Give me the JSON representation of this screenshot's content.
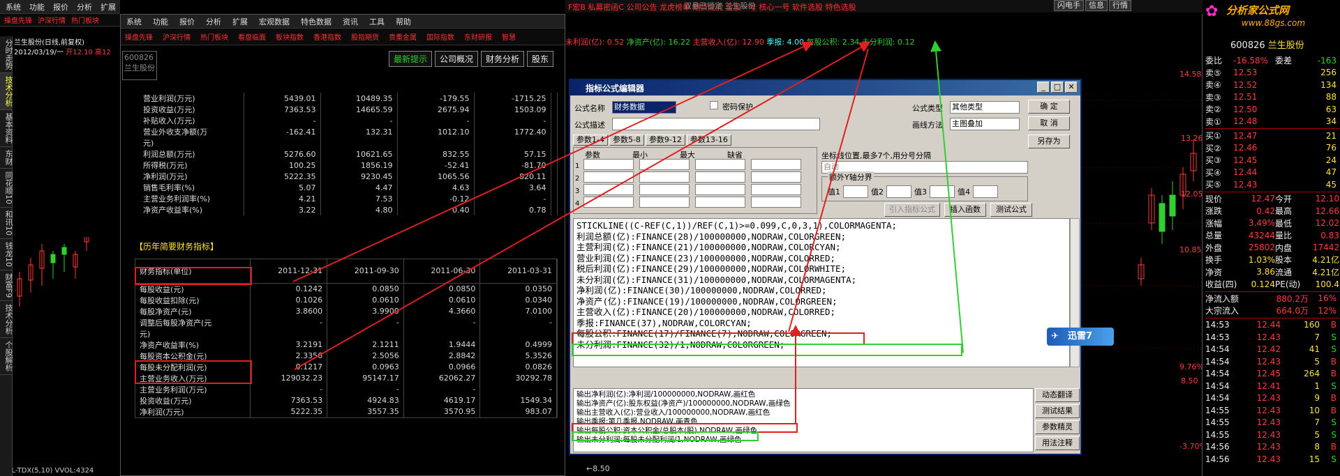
{
  "left_menu": [
    "系统",
    "功能",
    "报价",
    "分析",
    "扩展"
  ],
  "left_redbar": [
    "操盘先锋",
    "沪深行情",
    "热门板块"
  ],
  "vtabs": [
    "分时走势",
    "技术分析",
    "基本资料",
    "东财",
    "同花顺10",
    "和讯10",
    "钱龙10",
    "财富F9",
    "技术分析",
    "个股解析"
  ],
  "left_info": {
    "name": "兰生股份(日线,前复权)",
    "date": "2012/03/19/一",
    "open_label": "开12.10",
    "high_label": "高12"
  },
  "left_bottom": "VOL-TDX(5,10) VVOL:4324",
  "fin_menu": [
    "系统",
    "功能",
    "报价",
    "分析",
    "扩展",
    "宏观数据",
    "特色数据",
    "资讯",
    "工具",
    "帮助"
  ],
  "fin_redbar": [
    "操盘先锋",
    "沪深行情",
    "热门板块",
    "看盘临面",
    "板块指数",
    "香港指数",
    "股指期货",
    "贵重金属",
    "国际指数",
    "东财研报",
    "智慧"
  ],
  "fin_code": "600826",
  "fin_name": "兰生股份",
  "fin_tabs": [
    "最新提示",
    "公司概况",
    "财务分析",
    "股东"
  ],
  "fin_rows1": [
    [
      "营业利润(万元)",
      "5439.01",
      "10489.35",
      "-179.55",
      "-1715.25"
    ],
    [
      "投资收益(万元)",
      "7363.53",
      "14665.59",
      "2675.94",
      "1503.09"
    ],
    [
      "补贴收入(万元)",
      "-",
      "-",
      "-",
      "-"
    ],
    [
      "营业外收支净额(万",
      "-162.41",
      "132.31",
      "1012.10",
      "1772.40"
    ],
    [
      "元)",
      "",
      "",
      "",
      ""
    ],
    [
      "利润总额(万元)",
      "5276.60",
      "10621.65",
      "832.55",
      "57.15"
    ],
    [
      "所得税(万元)",
      "100.25",
      "1856.19",
      "-52.41",
      "-81.70"
    ],
    [
      "净利润(万元)",
      "5222.35",
      "9230.45",
      "1065.56",
      "820.11"
    ],
    [
      "销售毛利率(%)",
      "5.07",
      "4.47",
      "4.63",
      "3.64"
    ],
    [
      "主营业务利润率(%)",
      "4.21",
      "7.53",
      "-0.12",
      "-"
    ],
    [
      "净资产收益率(%)",
      "3.22",
      "4.80",
      "0.40",
      "0.78"
    ]
  ],
  "fin_section": "【历年简要财务指标】",
  "fin_header": [
    "财务指标(单位)",
    "2011-12-31",
    "2011-09-30",
    "2011-06-30",
    "2011-03-31"
  ],
  "fin_rows2": [
    [
      "每股收益(元)",
      "0.1242",
      "0.0850",
      "0.0850",
      "0.0350"
    ],
    [
      "每股收益扣除(元)",
      "0.1026",
      "0.0610",
      "0.0610",
      "0.0340"
    ],
    [
      "每股净资产(元)",
      "3.8600",
      "3.9900",
      "4.3660",
      "7.0100"
    ],
    [
      "调整后每股净资产(元",
      "-",
      "-",
      "-",
      "-"
    ],
    [
      "元)",
      "",
      "",
      "",
      ""
    ],
    [
      "净资产收益率(%)",
      "3.2191",
      "2.1211",
      "1.9444",
      "0.4999"
    ],
    [
      "每股资本公积金(元)",
      "2.3356",
      "2.5056",
      "2.8842",
      "5.3526"
    ],
    [
      "每股未分配利润(元)",
      "0.1217",
      "0.0963",
      "0.0966",
      "0.0826"
    ],
    [
      "主营业务收入(万元)",
      "129032.23",
      "95147.17",
      "62062.27",
      "30292.78"
    ],
    [
      "主营业务利润(万元)",
      "-",
      "-",
      "-",
      "-"
    ],
    [
      "投资收益(万元)",
      "7363.53",
      "4924.83",
      "4619.17",
      "1549.34"
    ],
    [
      "净利润(万元)",
      "5222.35",
      "3557.35",
      "3570.95",
      "983.07"
    ]
  ],
  "chart_top": {
    "bar": "F宏B  私募密函C  公司公告  龙虎榜单  期货龙虎  金股一号  核心一号  软件选股  特色选股",
    "title": "双悬已锁定 兰生股份",
    "status": [
      "闪电手",
      "信息",
      "行情"
    ]
  },
  "indicator_line": {
    "p1": "未利润(亿): 0.52",
    "p2": "净资产(亿): 16.22",
    "p3": "主营收入(亿): 12.90",
    "p4": "季报: 4.00",
    "p5": "每股公积: 2.34",
    "p6": "未分利润: 0.12"
  },
  "price_axis": [
    "14.58%",
    "13.26",
    "12.05",
    "10.85%",
    "9.76%",
    "8.50",
    "-3.70%"
  ],
  "bottom_axis": "←8.50",
  "dialog": {
    "title": "指标公式编辑器",
    "name_label": "公式名称",
    "name_value": "财务数据",
    "pwd_label": "密码保护",
    "desc_label": "公式描述",
    "type_label": "公式类型",
    "type_value": "其他类型",
    "draw_label": "画线方法",
    "draw_value": "主图叠加",
    "btn_ok": "确  定",
    "btn_cancel": "取  消",
    "btn_saveas": "另存为",
    "param_tabs": [
      "参数1-4",
      "参数5-8",
      "参数9-12",
      "参数13-16"
    ],
    "param_headers": [
      "参数",
      "最小",
      "最大",
      "缺省"
    ],
    "coord_label": "坐标线位置,最多7个,用分号分隔",
    "coord_value": "自动",
    "yaxis_label": "额外Y轴分界",
    "yvals": [
      "值1",
      "值2",
      "值3",
      "值4"
    ],
    "btn_import": "引入指标公式",
    "btn_insert": "插入函数",
    "btn_test": "测试公式",
    "code": [
      "STICKLINE((C-REF(C,1))/REF(C,1)>=0.099,C,0,3,1),COLORMAGENTA;",
      "利润总额(亿):FINANCE(28)/100000000,NODRAW,COLORGREEN;",
      "主营利润(亿):FINANCE(21)/100000000,NODRAW,COLORCYAN;",
      "营业利润(亿):FINANCE(23)/100000000,NODRAW,COLORRED;",
      "税后利润(亿):FINANCE(29)/100000000,NODRAW,COLORWHITE;",
      "未分利润(亿):FINANCE(31)/100000000,NODRAW,COLORMAGENTA;",
      "净利润(亿):FINANCE(30)/100000000,NODRAW,COLORRED;",
      "净资产(亿):FINANCE(19)/100000000,NODRAW,COLORGREEN;",
      "主营收入(亿):FINANCE(20)/100000000,NODRAW,COLORRED;",
      "季报:FINANCE(37),NODRAW,COLORCYAN;",
      "每股公积:FINANCE(17)/FINANCE(7),NODRAW,COLORGREEN;",
      "未分利润:FINANCE(32)/1,NODRAW,COLORGREEN;"
    ],
    "output": [
      "输出净利润(亿):净利润/100000000,NODRAW,画红色",
      "输出净资产(亿):股东权益(净资产)/100000000,NODRAW,画绿色",
      "输出主营收入(亿):营业收入/100000000,NODRAW,画红色",
      "输出季报:第几季报,NODRAW,画青色",
      "输出每股公积:资本公积金/总股本(股),NODRAW,画绿色",
      "输出未分利润:每股未分配利润/1,NODRAW,画绿色"
    ],
    "side_btns": [
      "动态翻译",
      "测试结果",
      "参数精灵",
      "用法注释"
    ]
  },
  "xunlei": "迅雷7",
  "rp": {
    "logo": "分析家公式网",
    "logo_url": "www.88gs.com",
    "code": "600826",
    "name": "兰生股份",
    "weibi": [
      "委比",
      "-16.58%",
      "委差",
      "-163"
    ],
    "sells": [
      [
        "卖⑤",
        "12.53",
        "256"
      ],
      [
        "卖④",
        "12.52",
        "134"
      ],
      [
        "卖③",
        "12.51",
        "88"
      ],
      [
        "卖②",
        "12.50",
        "63"
      ],
      [
        "卖①",
        "12.48",
        "34"
      ]
    ],
    "buys": [
      [
        "买①",
        "12.47",
        "21"
      ],
      [
        "买②",
        "12.46",
        "76"
      ],
      [
        "买③",
        "12.45",
        "24"
      ],
      [
        "买④",
        "12.44",
        "47"
      ],
      [
        "买⑤",
        "12.43",
        "45"
      ]
    ],
    "stats": [
      [
        "现价",
        "12.47",
        "今开",
        "12.10"
      ],
      [
        "涨跌",
        "0.42",
        "最高",
        "12.66"
      ],
      [
        "涨幅",
        "3.49%",
        "最低",
        "12.02"
      ],
      [
        "总量",
        "43244",
        "量比",
        "0.83"
      ],
      [
        "外盘",
        "25802",
        "内盘",
        "17442"
      ],
      [
        "换手",
        "1.03%",
        "股本",
        "4.21亿"
      ],
      [
        "净资",
        "3.86",
        "流通",
        "4.21亿"
      ],
      [
        "收益(四)",
        "0.124",
        "PE(动)",
        "100.4"
      ]
    ],
    "flow": [
      [
        "净流入额",
        "880.2万",
        "16%"
      ],
      [
        "大宗流入",
        "664.0万",
        "12%"
      ]
    ],
    "ticks": [
      [
        "14:53",
        "12.44",
        "160",
        "B"
      ],
      [
        "14:53",
        "12.43",
        "7",
        "S"
      ],
      [
        "14:54",
        "12.42",
        "41",
        "S"
      ],
      [
        "14:54",
        "12.43",
        "5",
        "B"
      ],
      [
        "14:54",
        "12.45",
        "264",
        "B"
      ],
      [
        "14:54",
        "12.41",
        "1",
        "S"
      ],
      [
        "14:54",
        "12.43",
        "9",
        "B"
      ],
      [
        "14:55",
        "12.43",
        "10",
        "B"
      ],
      [
        "14:55",
        "12.43",
        "7",
        "S"
      ],
      [
        "14:55",
        "12.43",
        "5",
        "S"
      ],
      [
        "14:56",
        "12.43",
        "8",
        "B"
      ],
      [
        "14:56",
        "12.43",
        "15",
        "S"
      ]
    ]
  },
  "colors": {
    "up": "#ff3c3c",
    "down": "#2fd02f",
    "accent": "#ffe23a",
    "dialog_title": "#0a246a"
  }
}
